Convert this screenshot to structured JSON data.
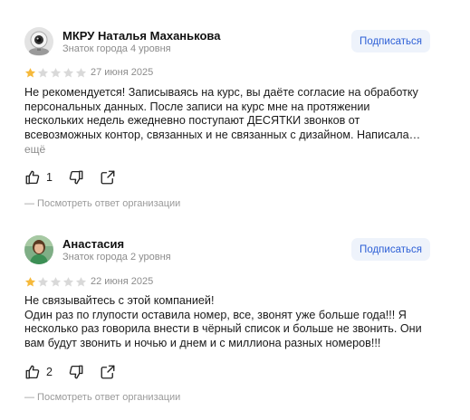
{
  "reviews": [
    {
      "author": "МКРУ Наталья Маханькова",
      "level": "Знаток города 4 уровня",
      "subscribe_label": "Подписаться",
      "rating": 1,
      "date": "27 июня 2025",
      "text_lines": [
        "Не рекомендуется! Записываясь на курс, вы даёте согласие на обработку",
        "персональных данных. После записи на курс мне на протяжении",
        "нескольких недель ежедневно поступают ДЕСЯТКИ звонков от",
        "всевозможных контор, связанных и не связанных с дизайном. Написала…"
      ],
      "more_label": "ещё",
      "likes": "1",
      "org_reply_label": "— Посмотреть ответ организации",
      "avatar_icon": "webcam-avatar"
    },
    {
      "author": "Анастасия",
      "level": "Знаток города 2 уровня",
      "subscribe_label": "Подписаться",
      "rating": 1,
      "date": "22 июня 2025",
      "text_lines": [
        "Не связывайтесь с этой компанией!",
        "Один раз по глупости оставила номер, все, звонят уже больше года!!! Я",
        "несколько раз говорила внести в чёрный список и больше не звонить. Они",
        "вам будут звонить и ночью и днем и с миллиона разных номеров!!!"
      ],
      "likes": "2",
      "org_reply_label": "— Посмотреть ответ организации",
      "avatar_icon": "user-photo-avatar"
    }
  ],
  "colors": {
    "star_filled": "#f6b93b",
    "star_empty": "#d9d9d9",
    "accent": "#2c5fd6",
    "muted": "#8c8c8c"
  },
  "icons": [
    "like-icon",
    "dislike-icon",
    "share-icon",
    "star-icon"
  ]
}
